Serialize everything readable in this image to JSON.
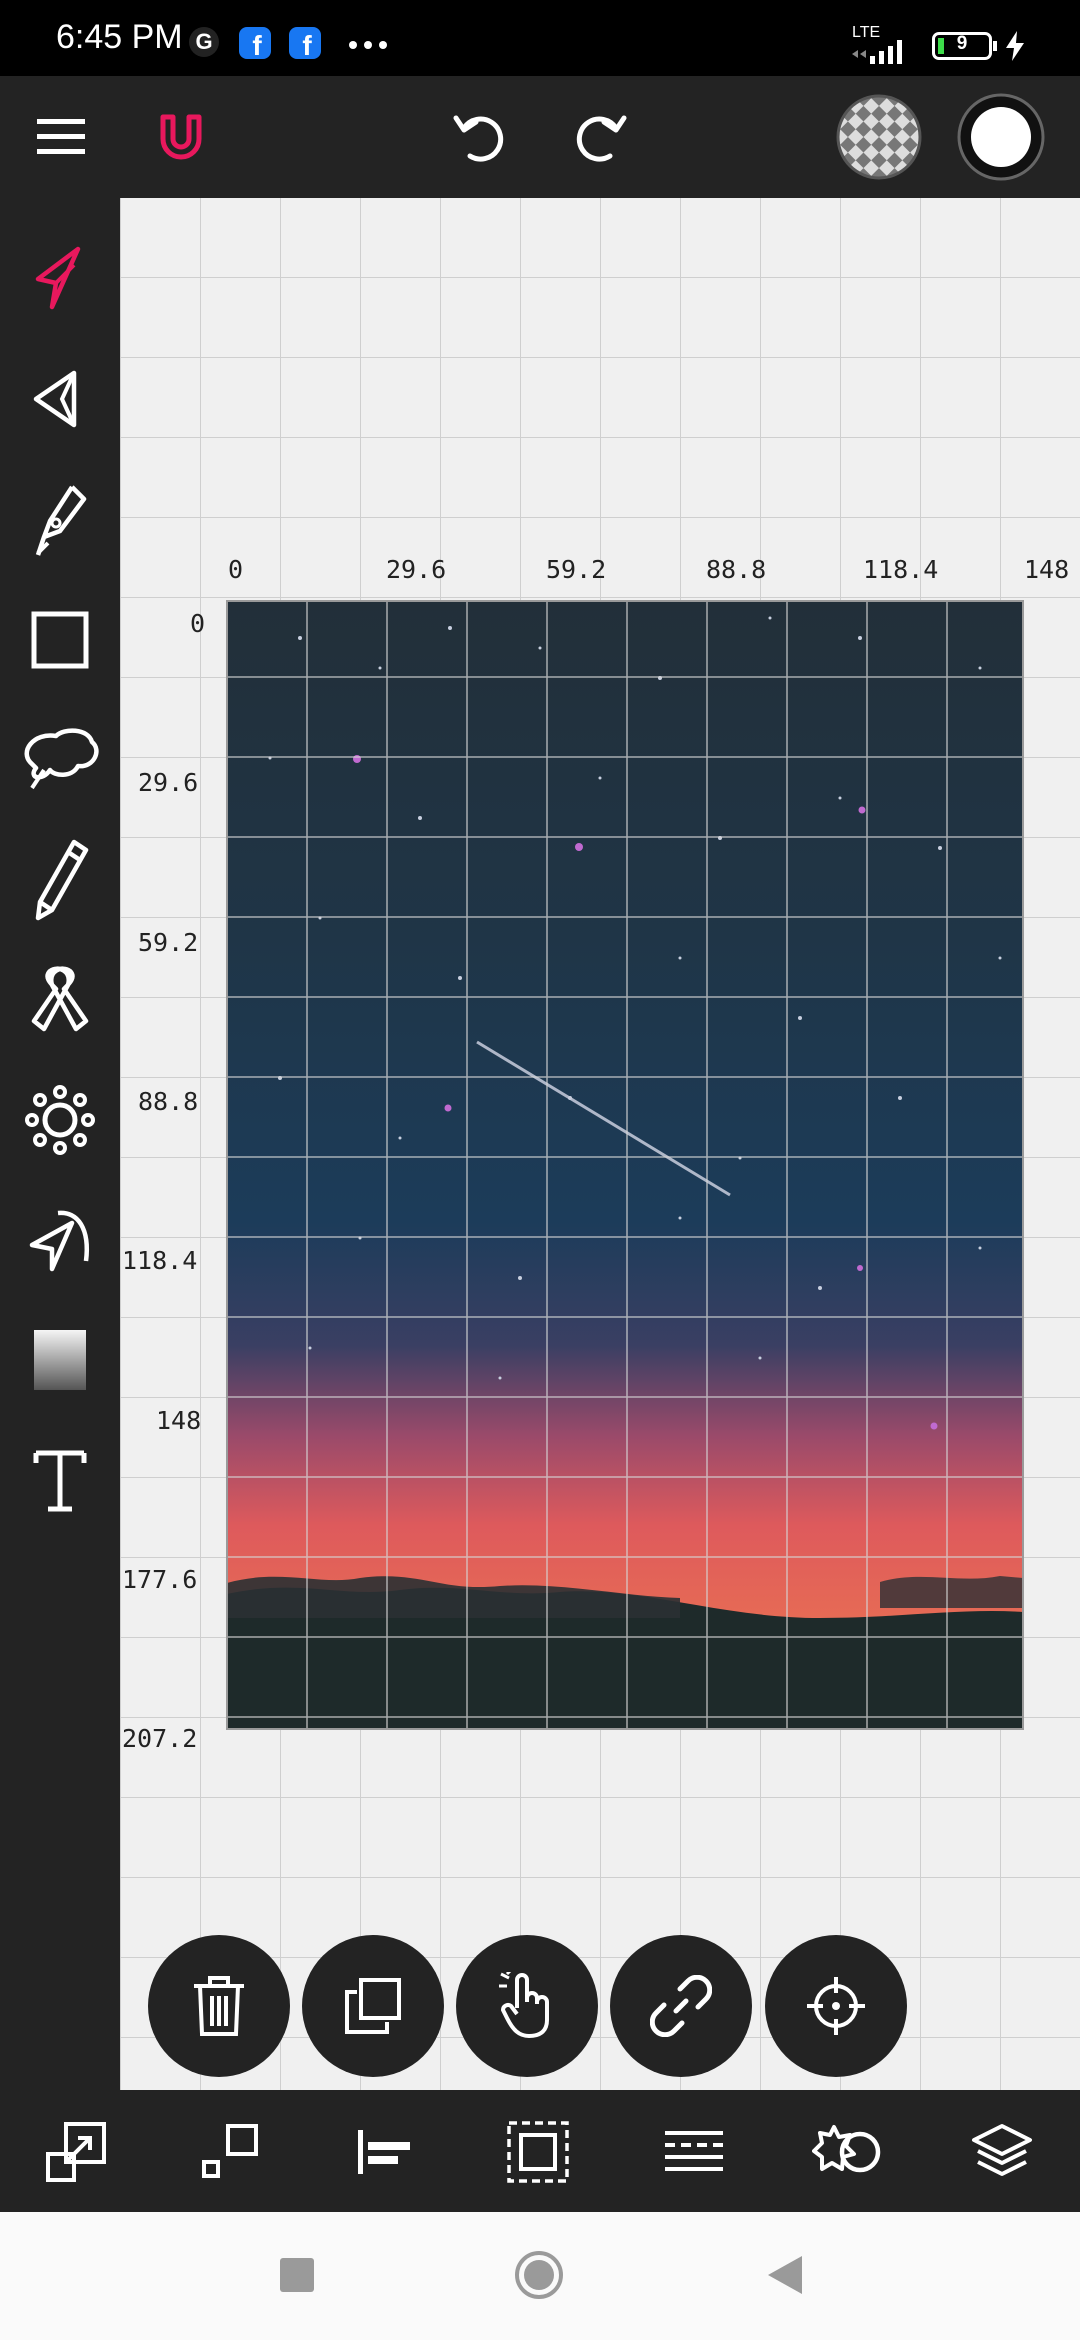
{
  "status_bar": {
    "time": "6:45 PM",
    "network": "LTE",
    "battery": "9",
    "notifications": [
      "g-icon",
      "facebook-icon",
      "facebook-icon",
      "more-icon"
    ]
  },
  "top_toolbar": {
    "icons": [
      "menu-icon",
      "magnet-icon",
      "undo-icon",
      "redo-icon",
      "transparency-swatch-icon",
      "color-swatch-icon"
    ],
    "accent_color": "#e8185d",
    "selected_color": "#ffffff"
  },
  "left_toolbar": {
    "tools": [
      "select-tool-icon",
      "direct-select-tool-icon",
      "pen-tool-icon",
      "rectangle-tool-icon",
      "shape-tool-icon",
      "pencil-tool-icon",
      "ribbon-tool-icon",
      "sun-shape-tool-icon",
      "arc-tool-icon",
      "gradient-tool-icon",
      "text-tool-icon"
    ],
    "active_tool": "select-tool-icon"
  },
  "canvas": {
    "x_ruler": [
      "0",
      "29.6",
      "59.2",
      "88.8",
      "118.4",
      "148"
    ],
    "y_ruler": [
      "0",
      "29.6",
      "59.2",
      "88.8",
      "118.4",
      "148",
      "177.6",
      "207.2"
    ],
    "image_description_colors": [
      "#1f2a35",
      "#1b3a55",
      "#e2555a",
      "#1d2b2a"
    ]
  },
  "selection_actions": [
    "delete-icon",
    "duplicate-icon",
    "hand-icon",
    "link-icon",
    "crosshair-icon"
  ],
  "bottom_toolbar": {
    "icons": [
      "resize-icon",
      "align-icon",
      "align-left-icon",
      "crop-icon",
      "distribute-icon",
      "effects-icon",
      "layers-icon"
    ]
  },
  "nav_bar": {
    "icons": [
      "recents-button",
      "home-button",
      "back-button"
    ]
  }
}
